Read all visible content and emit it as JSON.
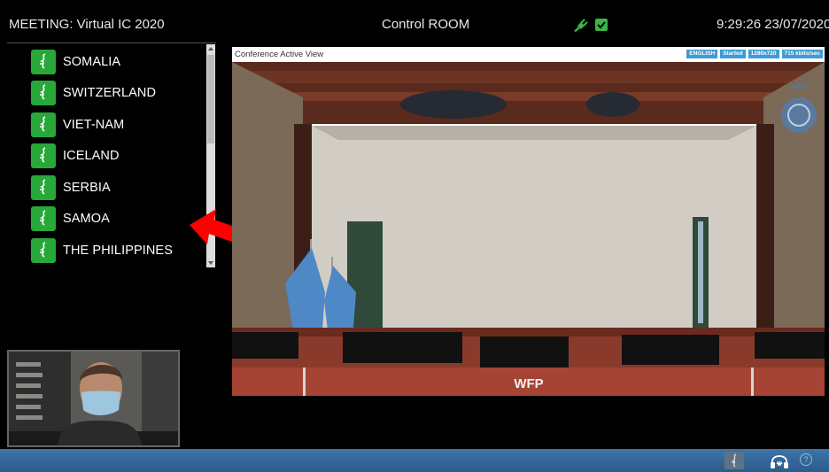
{
  "header": {
    "meeting_title": "MEETING: Virtual IC 2020",
    "room_title": "Control ROOM",
    "clock": "9:29:26 23/07/2020",
    "status_icons": [
      "plug-icon",
      "checkbox-checked-icon"
    ],
    "status_color": "#39b54a"
  },
  "countries": [
    {
      "label": "SOMALIA",
      "icon": "microphone-icon"
    },
    {
      "label": "SWITZERLAND",
      "icon": "microphone-icon"
    },
    {
      "label": "VIET-NAM",
      "icon": "microphone-icon"
    },
    {
      "label": "ICELAND",
      "icon": "microphone-icon"
    },
    {
      "label": "SERBIA",
      "icon": "microphone-icon"
    },
    {
      "label": "SAMOA",
      "icon": "microphone-icon"
    },
    {
      "label": "THE PHILIPPINES",
      "icon": "microphone-icon"
    }
  ],
  "mic_button_color": "#29a83a",
  "annotation_arrow_color": "#ff0000",
  "video": {
    "title": "Conference Active View",
    "badges": [
      "ENGLISH",
      "Started",
      "1280x720",
      "715 kbits/sec"
    ],
    "badge_color": "#3e9bd4",
    "scene": {
      "org_logo_text": "WFP",
      "desk_sign": "WFP"
    }
  },
  "footer": {
    "icons": [
      "microphone-icon",
      "headset-icon",
      "help-icon"
    ],
    "help_label": "?",
    "bar_color": "#2b5b8c"
  }
}
